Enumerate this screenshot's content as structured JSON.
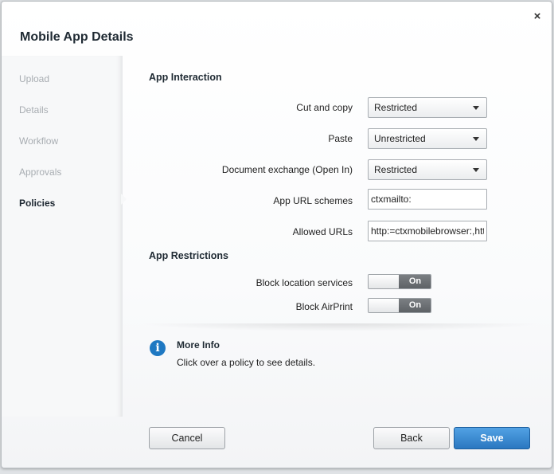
{
  "dialog": {
    "title": "Mobile App Details",
    "close_symbol": "×"
  },
  "sidebar": {
    "items": [
      {
        "label": "Upload"
      },
      {
        "label": "Details"
      },
      {
        "label": "Workflow"
      },
      {
        "label": "Approvals"
      },
      {
        "label": "Policies",
        "active": true
      }
    ]
  },
  "app_interaction": {
    "title": "App Interaction",
    "cut_copy": {
      "label": "Cut and copy",
      "value": "Restricted"
    },
    "paste": {
      "label": "Paste",
      "value": "Unrestricted"
    },
    "document_exchange": {
      "label": "Document exchange (Open In)",
      "value": "Restricted"
    },
    "url_schemes": {
      "label": "App URL schemes",
      "value": "ctxmailto:"
    },
    "allowed_urls": {
      "label": "Allowed URLs",
      "value": "http:=ctxmobilebrowser:,https:=ctxmobilebrowsers:"
    }
  },
  "app_restrictions": {
    "title": "App Restrictions",
    "block_location": {
      "label": "Block location services",
      "state": "On"
    },
    "block_airprint": {
      "label": "Block AirPrint",
      "state": "On"
    }
  },
  "more_info": {
    "icon": "i",
    "title": "More Info",
    "text": "Click over a policy to see details."
  },
  "footer": {
    "cancel_label": "Cancel",
    "back_label": "Back",
    "save_label": "Save"
  },
  "colors": {
    "primary": "#2a77c0",
    "info_icon": "#1e78c2",
    "toggle_on": "#5e6266"
  }
}
